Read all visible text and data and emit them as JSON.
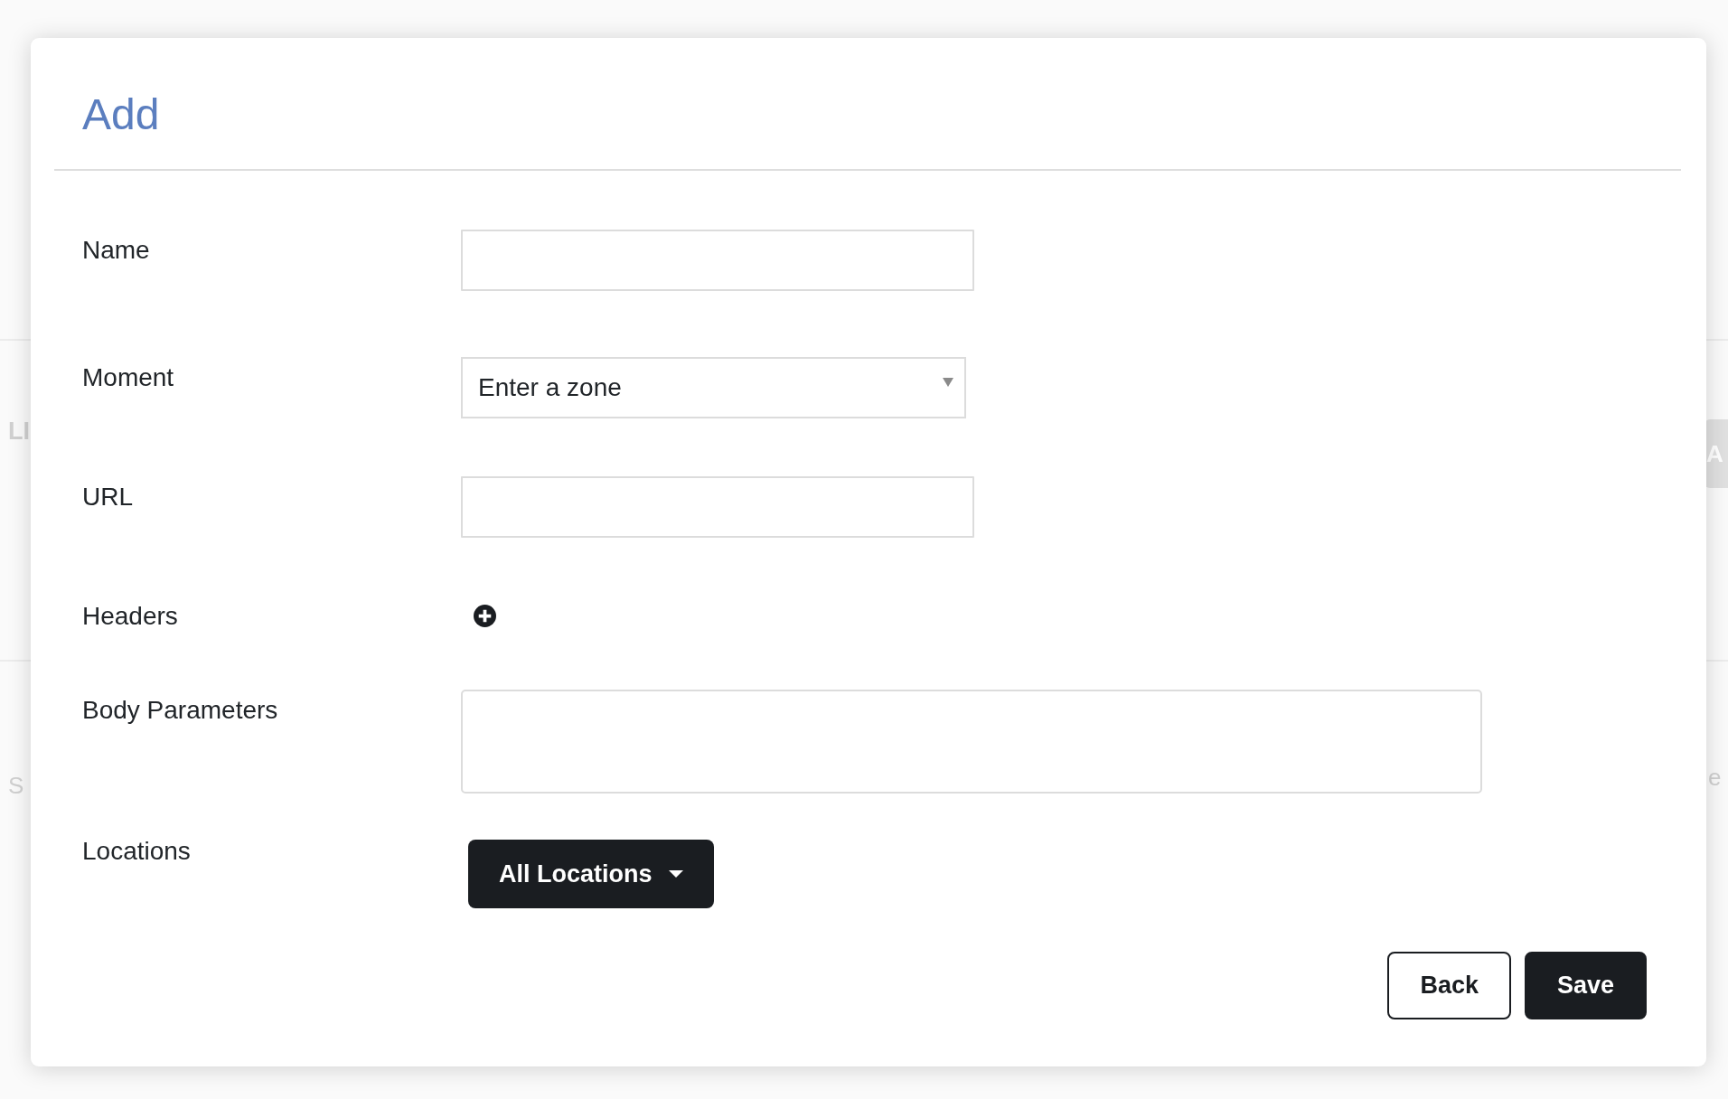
{
  "background_page": {
    "left_fragments": [
      {
        "kind": "heading",
        "text": "LI"
      },
      {
        "kind": "note",
        "text": "S"
      }
    ],
    "right_fragments": [
      {
        "kind": "button",
        "text": "A"
      },
      {
        "kind": "note",
        "text": "e"
      }
    ]
  },
  "dialog": {
    "title": "Add",
    "fields": [
      {
        "kind": "text",
        "label": "Name"
      },
      {
        "kind": "select",
        "label": "Moment",
        "value": "Enter a zone"
      },
      {
        "kind": "text",
        "label": "URL"
      },
      {
        "kind": "add",
        "label": "Headers"
      },
      {
        "kind": "textarea",
        "label": "Body Parameters"
      },
      {
        "kind": "dropdown",
        "label": "Locations",
        "button_label": "All Locations"
      }
    ],
    "buttons": [
      {
        "kind": "outline",
        "label": "Back"
      },
      {
        "kind": "primary",
        "label": "Save"
      }
    ]
  }
}
